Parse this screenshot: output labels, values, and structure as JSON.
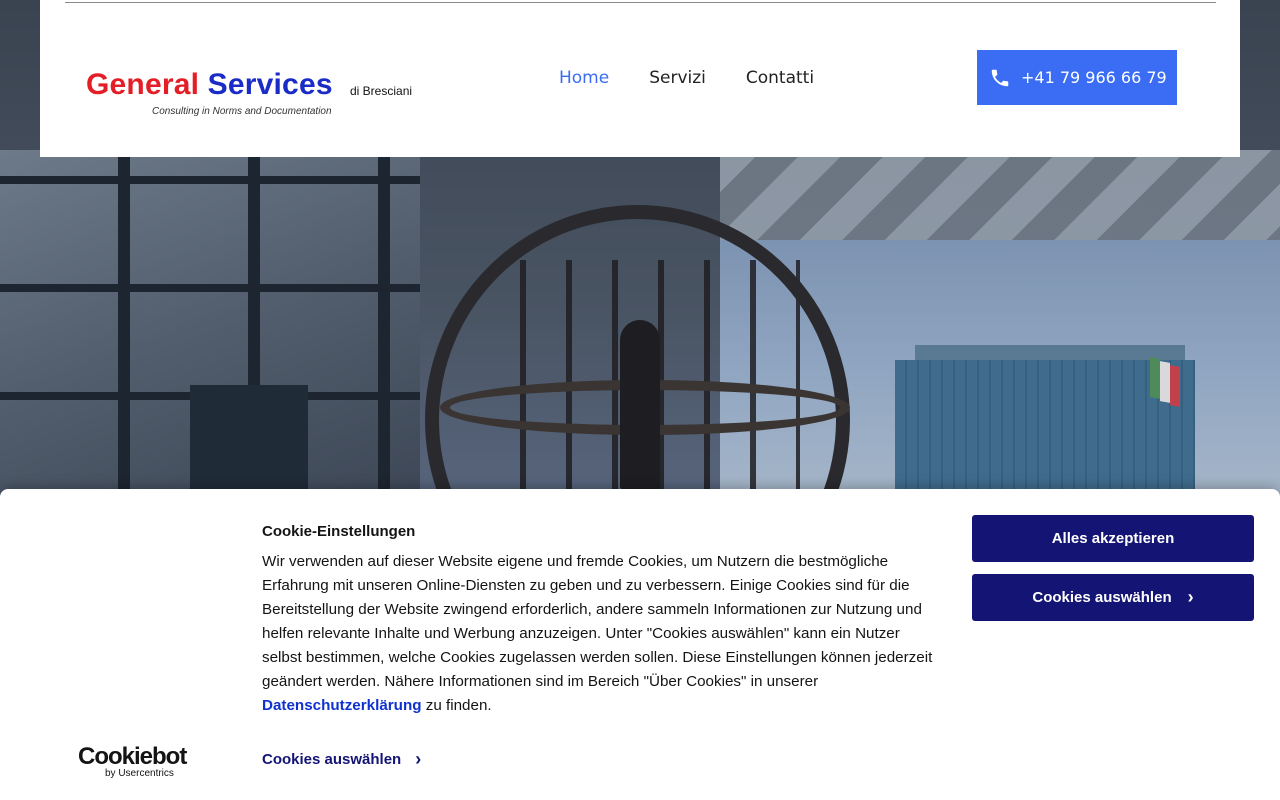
{
  "header": {
    "logo": {
      "general": "General",
      "services": "Services",
      "di": "di Bresciani",
      "subtitle": "Consulting in Norms and Documentation"
    },
    "nav": [
      {
        "label": "Home",
        "active": true
      },
      {
        "label": "Servizi",
        "active": false
      },
      {
        "label": "Contatti",
        "active": false
      }
    ],
    "phone": {
      "icon": "phone-icon",
      "label": "+41 79 966 66 79"
    }
  },
  "cookie_banner": {
    "title": "Cookie-Einstellungen",
    "text_before_link": "Wir verwenden auf dieser Website eigene und fremde Cookies, um Nutzern die bestmögliche Erfahrung mit unseren Online-Diensten zu geben und zu verbessern. Einige Cookies sind für die Bereitstellung der Website zwingend erforderlich, andere sammeln Informationen zur Nutzung und helfen relevante Inhalte und Werbung anzuzeigen. Unter \"Cookies auswählen\" kann ein Nutzer selbst bestimmen, welche Cookies zugelassen werden sollen. Diese Einstellungen können jederzeit geändert werden. Nähere Informationen sind im Bereich \"Über Cookies\" in unserer",
    "link": "Datenschutzerklärung",
    "text_after_link": "zu finden.",
    "details_label": "Cookies auswählen",
    "accept_label": "Alles akzeptieren",
    "select_label": "Cookies auswählen",
    "brand": {
      "name": "Cookiebot",
      "sub": "by Usercentrics"
    }
  },
  "colors": {
    "accent": "#3a6cf4",
    "banner_button": "#141475",
    "logo_red": "#e41e26",
    "logo_blue": "#1a2bc7"
  }
}
